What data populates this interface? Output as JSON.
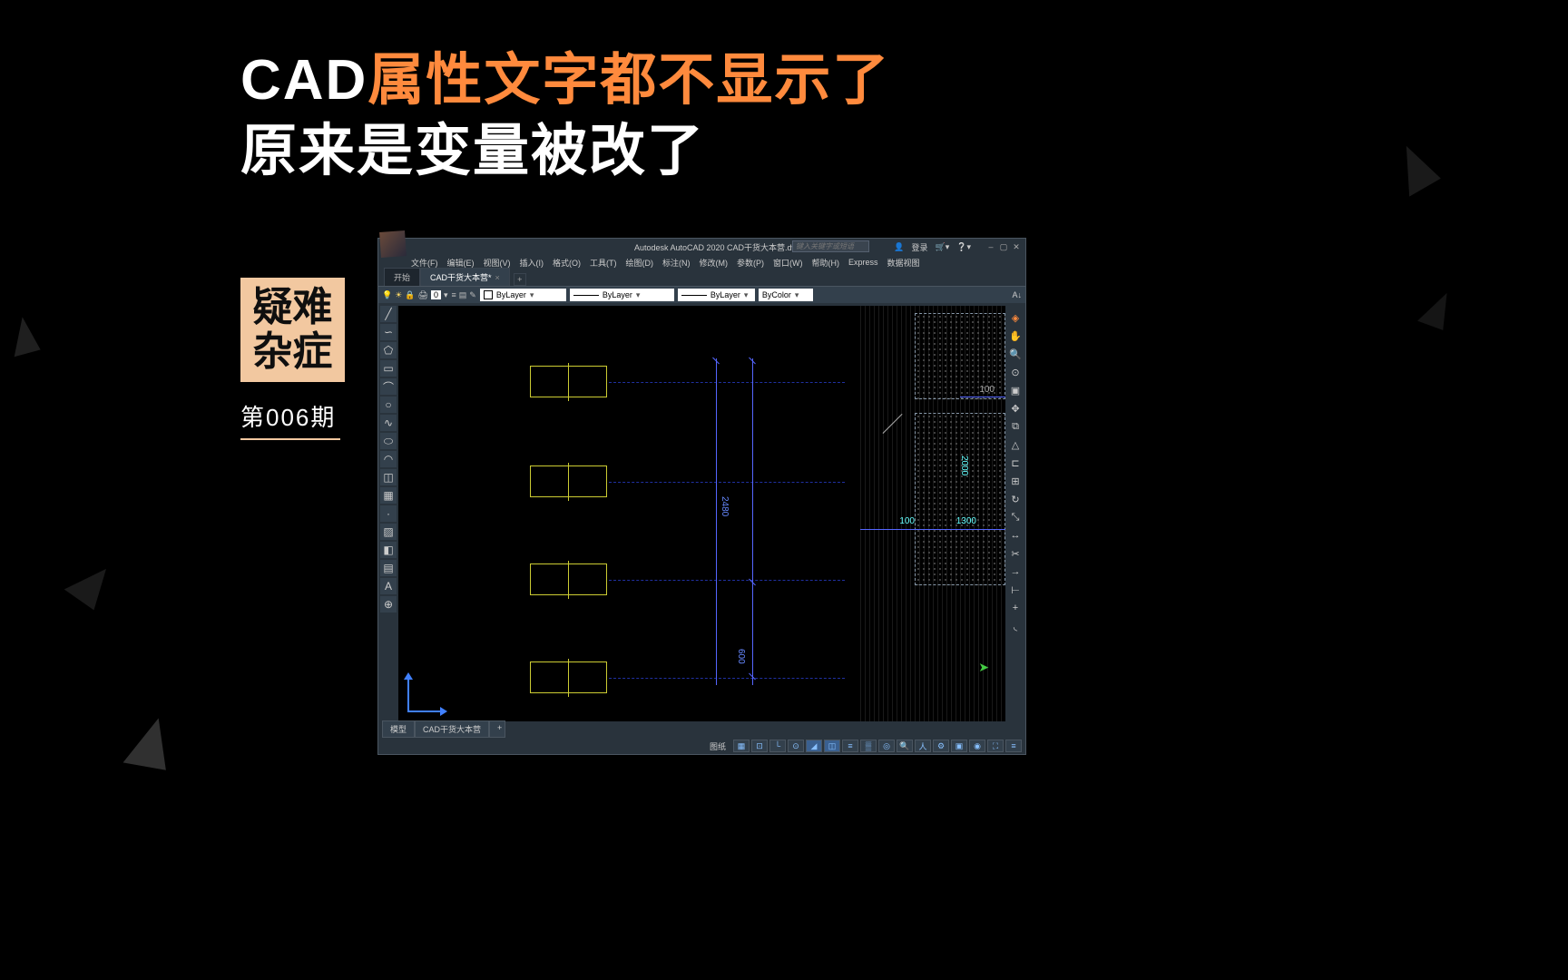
{
  "headline": {
    "part1": "CAD",
    "part2": "属性文字都不显示了",
    "line2": "原来是变量被改了"
  },
  "badge_line1": "疑难",
  "badge_line2": "杂症",
  "issue_no": "第006期",
  "cad": {
    "title": "Autodesk AutoCAD 2020    CAD干货大本营.dwg",
    "search_ph": "键入关键字或短语",
    "login": "登录",
    "menu": [
      "文件(F)",
      "编辑(E)",
      "视图(V)",
      "插入(I)",
      "格式(O)",
      "工具(T)",
      "绘图(D)",
      "标注(N)",
      "修改(M)",
      "参数(P)",
      "窗口(W)",
      "帮助(H)",
      "Express",
      "数据视图"
    ],
    "tab_start": "开始",
    "tab_doc": "CAD干货大本营*",
    "layer_num": "0",
    "layer_drop": "ByLayer",
    "linetype": "ByLayer",
    "lineweight": "ByLayer",
    "color": "ByColor",
    "bottom_tab_model": "模型",
    "bottom_tab_layout": "CAD干货大本营",
    "status_label": "图纸",
    "dims": {
      "d1": "2480",
      "d2": "600",
      "d3": "100",
      "d4": "2000",
      "d5": "1300",
      "d6": "100"
    }
  }
}
